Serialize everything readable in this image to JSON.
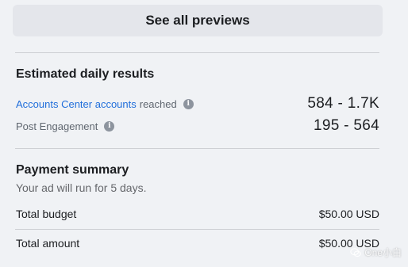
{
  "preview_button": {
    "label": "See all previews"
  },
  "estimated_results": {
    "title": "Estimated daily results",
    "metrics": [
      {
        "link_text": "Accounts Center accounts",
        "label_suffix": "reached",
        "value": "584 - 1.7K",
        "icon": "info-icon"
      },
      {
        "link_text": "",
        "label_suffix": "Post Engagement",
        "value": "195 - 564",
        "icon": "info-icon"
      }
    ]
  },
  "payment_summary": {
    "title": "Payment summary",
    "subtitle": "Your ad will run for 5 days.",
    "total_budget_label": "Total budget",
    "total_budget_value": "$50.00 USD",
    "total_amount_label": "Total amount",
    "total_amount_value": "$50.00 USD"
  },
  "watermark": {
    "text": "One小白",
    "icon": "wechat-icon"
  },
  "colors": {
    "background": "#f0f2f5",
    "button_bg": "#e4e6eb",
    "link": "#216fdb",
    "divider": "#ced0d4"
  }
}
